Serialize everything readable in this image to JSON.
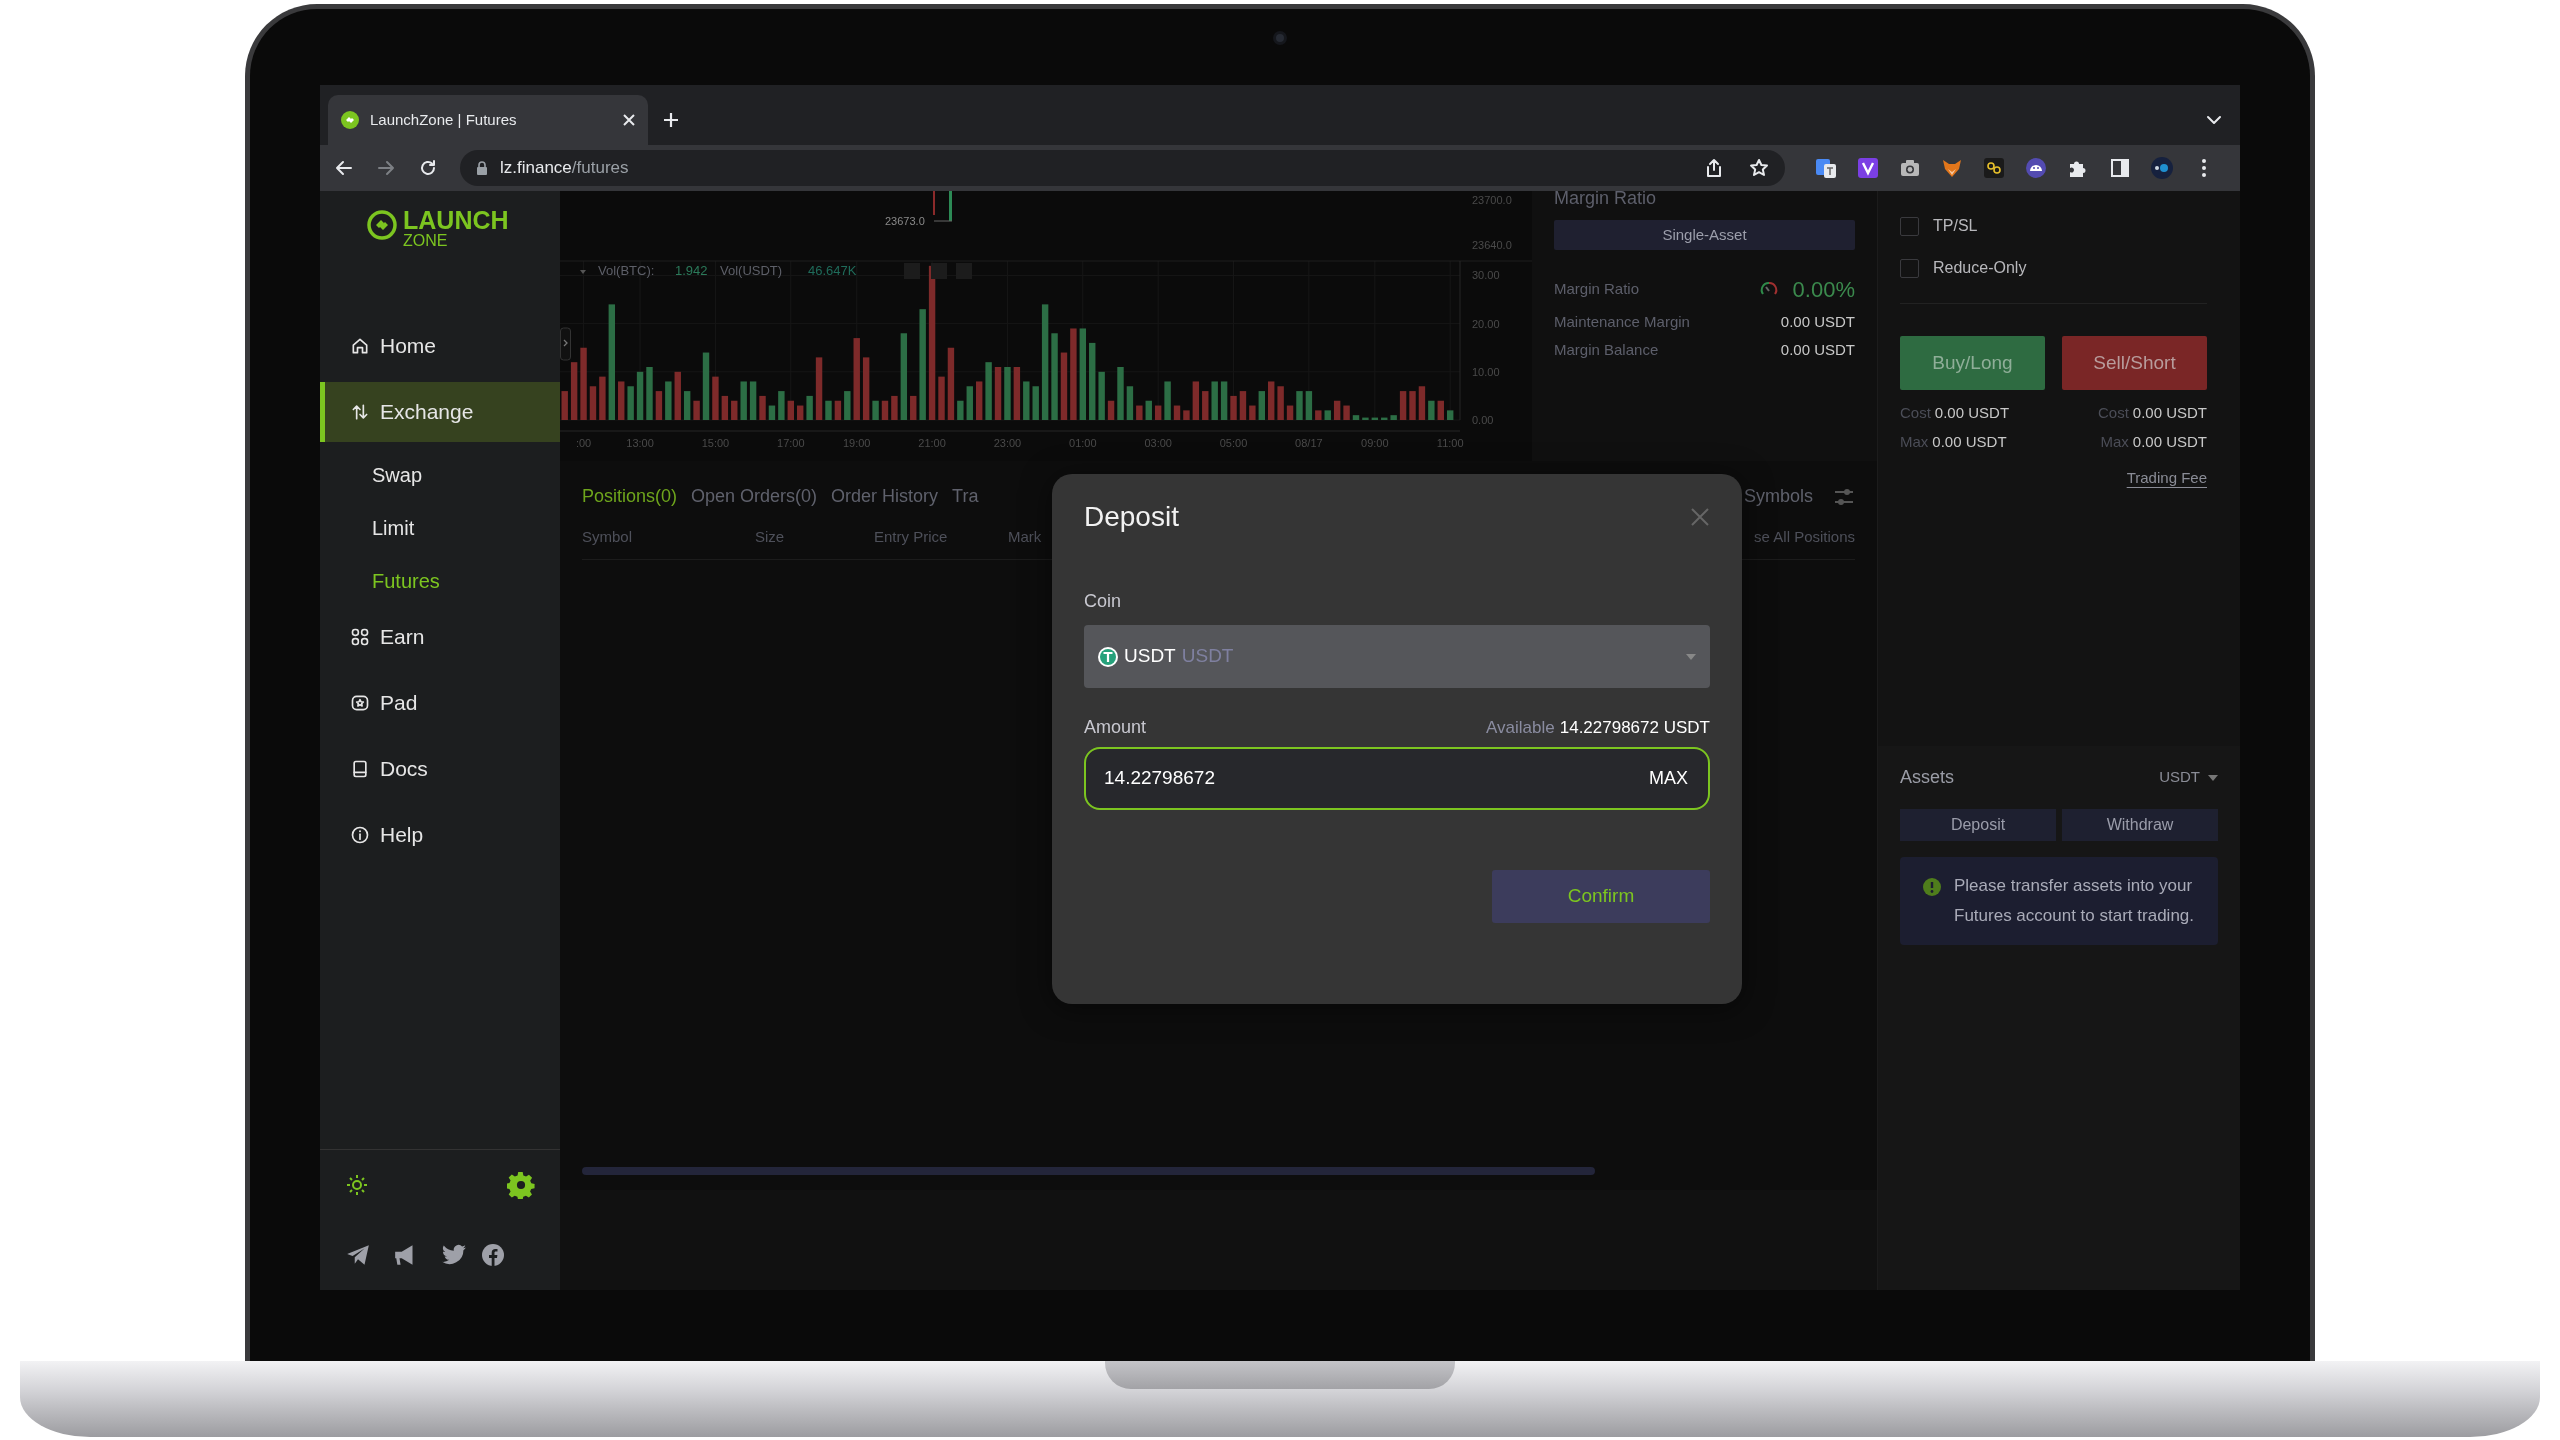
{
  "browser": {
    "tab_title": "LaunchZone | Futures",
    "url_host": "lz.finance",
    "url_path": "/futures"
  },
  "brand": {
    "name_top": "LAUNCH",
    "name_bottom": "ZONE"
  },
  "sidebar": {
    "items": [
      {
        "label": "Home",
        "kind": "home",
        "selected": false
      },
      {
        "label": "Exchange",
        "kind": "exchange",
        "selected": true,
        "children": [
          {
            "label": "Swap",
            "selected": false
          },
          {
            "label": "Limit",
            "selected": false
          },
          {
            "label": "Futures",
            "selected": true
          }
        ]
      },
      {
        "label": "Earn",
        "kind": "earn",
        "selected": false
      },
      {
        "label": "Pad",
        "kind": "pad",
        "selected": false
      },
      {
        "label": "Docs",
        "kind": "docs",
        "selected": false
      },
      {
        "label": "Help",
        "kind": "help",
        "selected": false
      }
    ]
  },
  "chart": {
    "price_ticks": [
      "23700.0",
      "23640.0"
    ],
    "last_price": "23673.0",
    "legend": [
      {
        "label": "Vol(BTC):",
        "value": "1.942"
      },
      {
        "label": "Vol(USDT)",
        "value": "46.647K"
      }
    ],
    "chart_data": {
      "type": "bar",
      "stacked": true,
      "grid": true,
      "categories": [
        null,
        null,
        ":00",
        null,
        null,
        null,
        null,
        null,
        "13:00",
        null,
        null,
        null,
        null,
        null,
        null,
        null,
        "15:00",
        null,
        null,
        null,
        null,
        null,
        null,
        null,
        "17:00",
        null,
        null,
        null,
        null,
        null,
        null,
        "19:00",
        null,
        null,
        null,
        null,
        null,
        null,
        null,
        "21:00",
        null,
        null,
        null,
        null,
        null,
        null,
        null,
        "23:00",
        null,
        null,
        null,
        null,
        null,
        null,
        null,
        "01:00",
        null,
        null,
        null,
        null,
        null,
        null,
        null,
        "03:00",
        null,
        null,
        null,
        null,
        null,
        null,
        null,
        "05:00",
        null,
        null,
        null,
        null,
        null,
        null,
        null,
        "08/17",
        null,
        null,
        null,
        null,
        null,
        null,
        "09:00",
        null,
        null,
        null,
        null,
        null,
        null,
        null,
        "11:00"
      ],
      "series": [
        {
          "color": "#2c6e45",
          "values": [
            null,
            null,
            null,
            null,
            null,
            24,
            null,
            7,
            10,
            11,
            null,
            8,
            null,
            6,
            null,
            14,
            null,
            null,
            null,
            8,
            8,
            null,
            3,
            6,
            null,
            null,
            5,
            null,
            4,
            null,
            6,
            null,
            null,
            4,
            null,
            null,
            18,
            null,
            23,
            null,
            null,
            null,
            4,
            7,
            null,
            12,
            null,
            11,
            null,
            8,
            7,
            24,
            18,
            null,
            null,
            19,
            16,
            10,
            null,
            11,
            7,
            null,
            4,
            null,
            8,
            null,
            null,
            null,
            null,
            8,
            8,
            null,
            null,
            null,
            6,
            null,
            null,
            null,
            6,
            6,
            null,
            2,
            null,
            null,
            1,
            0.5,
            0.5,
            0.5,
            1,
            null,
            null,
            null,
            4,
            null,
            2
          ]
        },
        {
          "color": "#7e2a2a",
          "values": [
            6,
            12,
            15,
            7,
            9,
            null,
            8,
            null,
            null,
            null,
            6,
            null,
            10,
            null,
            4,
            null,
            9,
            5,
            4,
            null,
            null,
            5,
            null,
            null,
            4,
            3,
            null,
            13,
            null,
            4,
            null,
            17,
            13,
            null,
            4,
            5,
            null,
            5,
            null,
            32,
            9,
            15,
            null,
            null,
            8,
            null,
            11,
            null,
            11,
            null,
            null,
            null,
            null,
            14,
            19,
            null,
            null,
            null,
            4,
            null,
            null,
            3,
            null,
            3,
            null,
            3,
            2,
            8,
            6,
            null,
            null,
            5,
            6,
            3,
            null,
            8,
            7,
            3,
            null,
            null,
            2,
            null,
            4,
            3,
            null,
            null,
            null,
            null,
            null,
            6,
            6,
            7,
            null,
            4,
            null
          ]
        }
      ],
      "ylim": [
        0,
        33
      ],
      "yticks": [
        {
          "value": 0,
          "label": "0.00"
        },
        {
          "value": 10,
          "label": "10.00"
        },
        {
          "value": 20,
          "label": "20.00"
        },
        {
          "value": 30,
          "label": "30.00"
        }
      ]
    }
  },
  "margin": {
    "title": "Margin Ratio",
    "mode_button": "Single-Asset",
    "rows": [
      {
        "label": "Margin Ratio",
        "value": "0.00%",
        "kind": "gauge"
      },
      {
        "label": "Maintenance Margin",
        "value": "0.00 USDT",
        "kind": "plain"
      },
      {
        "label": "Margin Balance",
        "value": "0.00 USDT",
        "kind": "plain"
      }
    ]
  },
  "positions": {
    "tabs": [
      {
        "label": "Positions(0)",
        "selected": true
      },
      {
        "label": "Open Orders(0)",
        "selected": false
      },
      {
        "label": "Order History",
        "selected": false
      },
      {
        "label": "Tra",
        "selected": false
      }
    ],
    "filter_label": "Symbols",
    "columns": [
      "Symbol",
      "Size",
      "Entry Price",
      "Mark"
    ],
    "close_all": "se All Positions"
  },
  "order": {
    "options": [
      {
        "label": "TP/SL",
        "checked": false
      },
      {
        "label": "Reduce-Only",
        "checked": false
      }
    ],
    "sides": [
      {
        "kind": "buy",
        "label": "Buy/Long",
        "cost_label": "Cost",
        "cost": "0.00 USDT",
        "max_label": "Max",
        "max": "0.00 USDT"
      },
      {
        "kind": "sell",
        "label": "Sell/Short",
        "cost_label": "Cost",
        "cost": "0.00 USDT",
        "max_label": "Max",
        "max": "0.00 USDT"
      }
    ],
    "fee_link": "Trading Fee"
  },
  "assets": {
    "title": "Assets",
    "currency": "USDT",
    "buttons": [
      "Deposit",
      "Withdraw"
    ],
    "notice": "Please transfer assets into your Futures account to start trading."
  },
  "modal": {
    "title": "Deposit",
    "coin_label": "Coin",
    "coin": {
      "symbol": "USDT",
      "name": "USDT"
    },
    "amount_label": "Amount",
    "available_label": "Available",
    "available": "14.22798672 USDT",
    "amount": "14.22798672",
    "max_button": "MAX",
    "confirm": "Confirm"
  }
}
